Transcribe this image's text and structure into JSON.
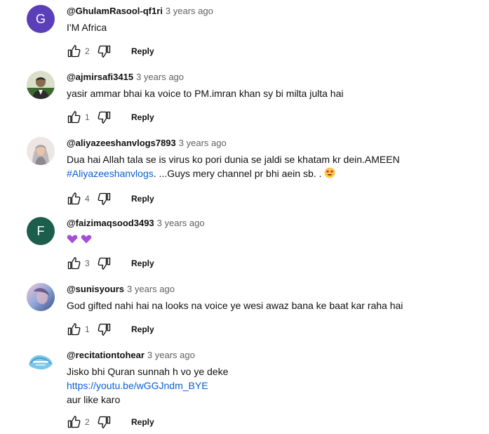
{
  "comments": [
    {
      "author": "@GhulamRasool-qf1ri",
      "time": "3 years ago",
      "avatar_letter": "G",
      "avatar_color": "#5b3fb8",
      "lines": [
        "I'M Africa"
      ],
      "likes": "2",
      "reply_label": "Reply"
    },
    {
      "author": "@ajmirsafi3415",
      "time": "3 years ago",
      "avatar_icon": "profile-photo-icon",
      "lines": [
        "yasir ammar bhai ka voice to PM.imran khan sy bi milta julta hai"
      ],
      "likes": "1",
      "reply_label": "Reply"
    },
    {
      "author": "@aliyazeeshanvlogs7893",
      "time": "3 years ago",
      "avatar_icon": "profile-photo-icon",
      "line1": "Dua hai Allah tala se is virus ko pori dunia se jaldi se khatam kr dein.AMEEN",
      "line2_link": "#Aliyazeeshanvlogs",
      "line2_text": ". ...Guys mery channel pr bhi aein sb. .",
      "line2_emoji": "heart-eyes-emoji",
      "likes": "4",
      "reply_label": "Reply"
    },
    {
      "author": "@faizimaqsood3493",
      "time": "3 years ago",
      "avatar_letter": "F",
      "avatar_color": "#1a5e4b",
      "emojis": [
        "purple-heart-emoji",
        "purple-heart-emoji"
      ],
      "likes": "3",
      "reply_label": "Reply"
    },
    {
      "author": "@sunisyours",
      "time": "3 years ago",
      "avatar_icon": "profile-photo-icon",
      "lines": [
        "God gifted nahi hai na looks na voice ye wesi awaz bana ke baat kar raha hai"
      ],
      "likes": "1",
      "reply_label": "Reply"
    },
    {
      "author": "@recitationtohear",
      "time": "3 years ago",
      "avatar_icon": "channel-logo-icon",
      "line1": "Jisko bhi Quran sunnah h vo ye deke",
      "link": "https://youtu.be/wGGJndm_BYE",
      "line3": "aur like karo",
      "likes": "2",
      "reply_label": "Reply"
    }
  ],
  "colors": {
    "link": "#065fd4",
    "secondary_text": "#606060",
    "purple_heart": "#a64fd6"
  }
}
